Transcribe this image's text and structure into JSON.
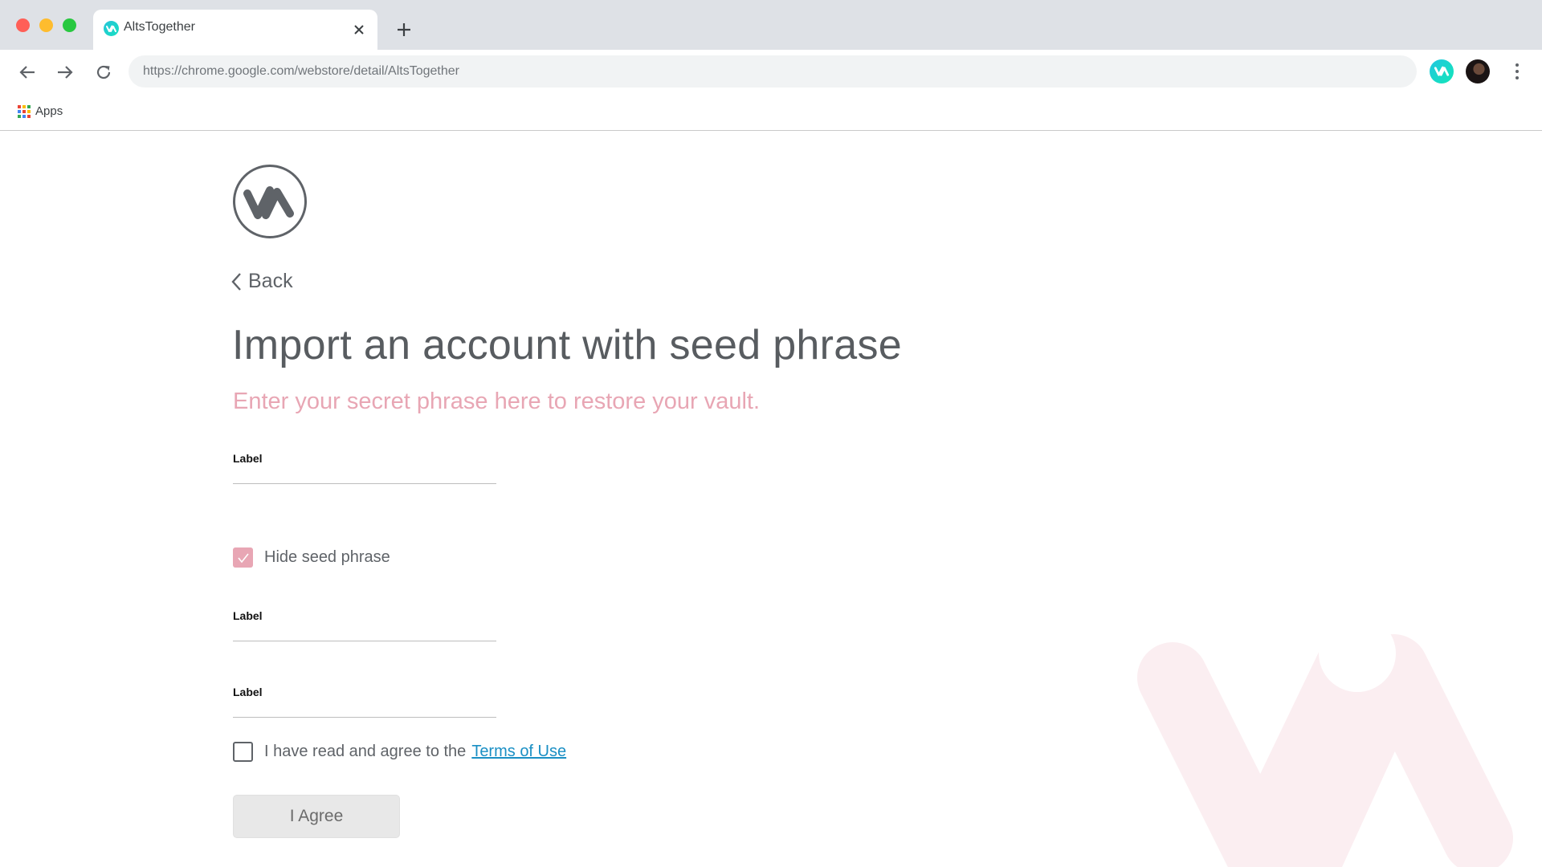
{
  "browser": {
    "tab_title": "AltsTogether",
    "url": "https://chrome.google.com/webstore/detail/AltsTogether",
    "bookmarks": [
      {
        "label": "Apps",
        "icon": "apps-grid-icon"
      }
    ]
  },
  "page": {
    "back_label": "Back",
    "title": "Import an account with seed phrase",
    "subtitle": "Enter your secret phrase here to restore your vault.",
    "fields": [
      {
        "label": "Label",
        "value": ""
      },
      {
        "label": "Label",
        "value": ""
      },
      {
        "label": "Label",
        "value": ""
      }
    ],
    "hide_seed": {
      "label": "Hide seed phrase",
      "checked": true
    },
    "terms": {
      "text": "I have read and agree to the",
      "link_text": "Terms of Use",
      "checked": false
    },
    "agree_button": "I Agree"
  },
  "colors": {
    "accent_pink": "#e8a6b4",
    "link_blue": "#1a8fc4",
    "brand_teal": "#22c7e0"
  }
}
